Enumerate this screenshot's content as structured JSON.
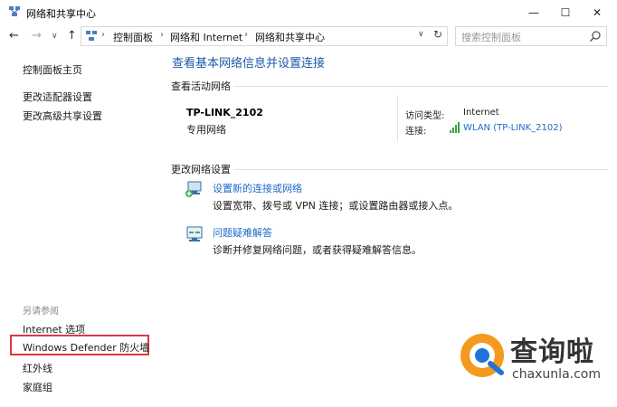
{
  "window": {
    "title": "网络和共享中心",
    "minimize_glyph": "—",
    "maximize_glyph": "☐",
    "close_glyph": "✕"
  },
  "nav": {
    "back_glyph": "←",
    "forward_glyph": "→",
    "history_glyph": "∨",
    "up_glyph": "↑",
    "breadcrumb": [
      "控制面板",
      "网络和 Internet",
      "网络和共享中心"
    ],
    "separator": "›",
    "dropdown_glyph": "∨",
    "refresh_glyph": "↻",
    "search_placeholder": "搜索控制面板"
  },
  "sidebar": {
    "home_link": "控制面板主页",
    "links": [
      "更改适配器设置",
      "更改高级共享设置"
    ],
    "see_also_heading": "另请参阅",
    "see_also": [
      "Internet 选项",
      "Windows Defender 防火墙",
      "红外线",
      "家庭组"
    ]
  },
  "main": {
    "title": "查看基本网络信息并设置连接",
    "active_networks_label": "查看活动网络",
    "network_name": "TP-LINK_2102",
    "network_type": "专用网络",
    "access_type_label": "访问类型:",
    "access_type_value": "Internet",
    "connection_label": "连接:",
    "connection_value": "WLAN (TP-LINK_2102)",
    "change_settings_label": "更改网络设置",
    "tasks": [
      {
        "link": "设置新的连接或网络",
        "desc": "设置宽带、拨号或 VPN 连接；或设置路由器或接入点。",
        "icon": "new-connection-icon"
      },
      {
        "link": "问题疑难解答",
        "desc": "诊断并修复网络问题，或者获得疑难解答信息。",
        "icon": "troubleshoot-icon"
      }
    ]
  },
  "watermark": {
    "text": "查询啦",
    "url": "chaxunla.com",
    "color_orange": "#f39a1f",
    "color_blue": "#1e74d8"
  },
  "colors": {
    "link": "#1e6bc8",
    "title": "#1e5aa8",
    "highlight_border": "#e0393e",
    "muted": "#8a8a8a"
  }
}
